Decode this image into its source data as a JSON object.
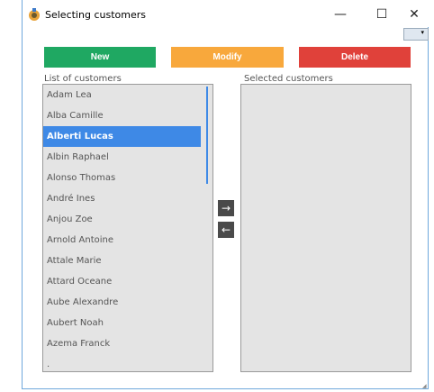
{
  "window": {
    "title": "Selecting customers",
    "icon": "app-icon",
    "minimize_glyph": "—",
    "maximize_glyph": "☐",
    "close_glyph": "✕",
    "context_glyph": "▾"
  },
  "toolbar": {
    "new_label": "New",
    "modify_label": "Modify",
    "delete_label": "Delete",
    "colors": {
      "new": "#1fa862",
      "modify": "#f8a83c",
      "delete": "#e0413a"
    }
  },
  "customers": {
    "label": "List of customers",
    "items": [
      "Adam Lea",
      "Alba Camille",
      "Alberti Lucas",
      "Albin Raphael",
      "Alonso Thomas",
      "André Ines",
      "Anjou Zoe",
      "Arnold Antoine",
      "Attale Marie",
      "Attard Oceane",
      "Aube Alexandre",
      "Aubert Noah",
      "Azema Franck",
      "."
    ],
    "selected_index": 2,
    "selection_color": "#3e89e6"
  },
  "selected": {
    "label": "Selected customers",
    "items": []
  },
  "transfer": {
    "add_glyph": "→",
    "remove_glyph": "←"
  }
}
